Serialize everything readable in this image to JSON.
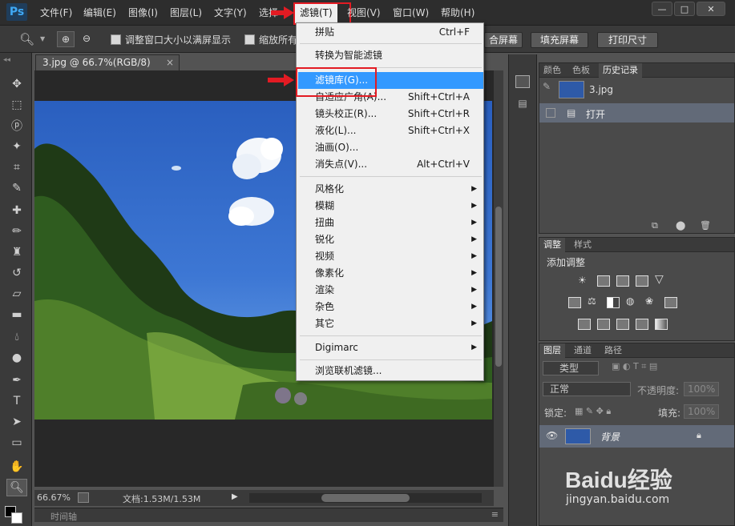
{
  "app": {
    "logo": "Ps"
  },
  "menubar": {
    "items": [
      "文件(F)",
      "编辑(E)",
      "图像(I)",
      "图层(L)",
      "文字(Y)",
      "选择",
      "滤镜(T)",
      "视图(V)",
      "窗口(W)",
      "帮助(H)"
    ],
    "window_controls": [
      "—",
      "□",
      "✕"
    ]
  },
  "options": {
    "checkbox1_label": "调整窗口大小以满屏显示",
    "checkbox2_label": "缩放所有",
    "btn_fill_screen_partial": "合屏幕",
    "btn_fill": "填充屏幕",
    "btn_print": "打印尺寸"
  },
  "document": {
    "tab_title": "3.jpg @ 66.7%(RGB/8)",
    "tab_close": "×"
  },
  "status": {
    "zoom": "66.67%",
    "doc_size": "文档:1.53M/1.53M",
    "timeline": "时间轴"
  },
  "filter_menu": {
    "items": [
      {
        "label": "拼贴",
        "shortcut": "Ctrl+F"
      },
      {
        "label": "转换为智能滤镜",
        "shortcut": ""
      },
      {
        "label": "滤镜库(G)...",
        "shortcut": ""
      },
      {
        "label": "自适应广角(A)...",
        "shortcut": "Shift+Ctrl+A"
      },
      {
        "label": "镜头校正(R)...",
        "shortcut": "Shift+Ctrl+R"
      },
      {
        "label": "液化(L)...",
        "shortcut": "Shift+Ctrl+X"
      },
      {
        "label": "油画(O)...",
        "shortcut": ""
      },
      {
        "label": "消失点(V)...",
        "shortcut": "Alt+Ctrl+V"
      },
      {
        "label": "风格化",
        "shortcut": ""
      },
      {
        "label": "模糊",
        "shortcut": ""
      },
      {
        "label": "扭曲",
        "shortcut": ""
      },
      {
        "label": "锐化",
        "shortcut": ""
      },
      {
        "label": "视频",
        "shortcut": ""
      },
      {
        "label": "像素化",
        "shortcut": ""
      },
      {
        "label": "渲染",
        "shortcut": ""
      },
      {
        "label": "杂色",
        "shortcut": ""
      },
      {
        "label": "其它",
        "shortcut": ""
      },
      {
        "label": "Digimarc",
        "shortcut": ""
      },
      {
        "label": "浏览联机滤镜...",
        "shortcut": ""
      }
    ]
  },
  "history_panel": {
    "tabs": [
      "颜色",
      "色板",
      "历史记录"
    ],
    "snapshot": "3.jpg",
    "step": "打开"
  },
  "adjust_panel": {
    "tabs": [
      "调整",
      "样式"
    ],
    "title": "添加调整"
  },
  "layers_panel": {
    "tabs": [
      "图层",
      "通道",
      "路径"
    ],
    "kind": "类型",
    "blend_mode": "正常",
    "opacity_label": "不透明度:",
    "opacity_value": "100%",
    "lock_label": "锁定:",
    "fill_label": "填充:",
    "fill_value": "100%",
    "layer_name": "背景"
  },
  "watermark": {
    "brand": "Baidu经验",
    "url": "jingyan.baidu.com"
  },
  "colors": {
    "accent_red": "#e31b23",
    "menu_highlight": "#3399ff",
    "ps_blue": "#3fa9f5"
  }
}
